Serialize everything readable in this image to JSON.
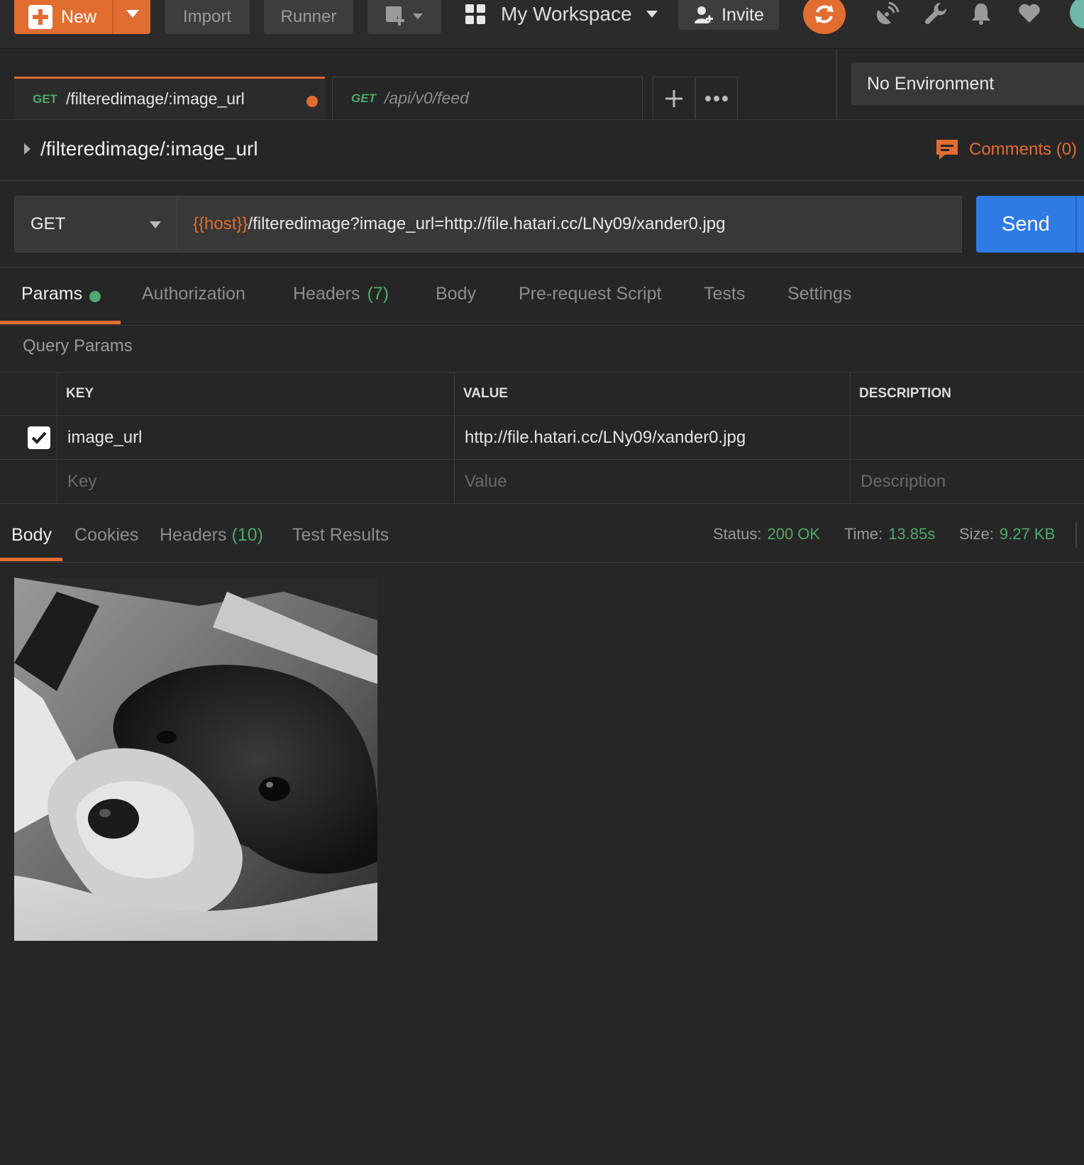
{
  "topbar": {
    "new_label": "New",
    "import_label": "Import",
    "runner_label": "Runner",
    "workspace_label": "My Workspace",
    "invite_label": "Invite"
  },
  "tabs": [
    {
      "method": "GET",
      "title": "/filteredimage/:image_url",
      "modified": true
    },
    {
      "method": "GET",
      "title": "/api/v0/feed",
      "modified": false
    }
  ],
  "environment": {
    "selected": "No Environment"
  },
  "request": {
    "title": "/filteredimage/:image_url",
    "comments_label": "Comments (0)",
    "method": "GET",
    "url_var": "{{host}}",
    "url_rest": "/filteredimage?image_url=http://file.hatari.cc/LNy09/xander0.jpg",
    "send_label": "Send"
  },
  "request_tabs": {
    "params": "Params",
    "authorization": "Authorization",
    "headers": "Headers",
    "headers_count": "(7)",
    "body": "Body",
    "prerequest": "Pre-request Script",
    "tests": "Tests",
    "settings": "Settings"
  },
  "query_params": {
    "label": "Query Params",
    "columns": {
      "key": "KEY",
      "value": "VALUE",
      "description": "DESCRIPTION"
    },
    "rows": [
      {
        "checked": true,
        "key": "image_url",
        "value": "http://file.hatari.cc/LNy09/xander0.jpg",
        "description": ""
      }
    ],
    "placeholders": {
      "key": "Key",
      "value": "Value",
      "description": "Description"
    }
  },
  "response": {
    "tabs": {
      "body": "Body",
      "cookies": "Cookies",
      "headers": "Headers",
      "headers_count": "(10)",
      "test_results": "Test Results"
    },
    "status_label": "Status:",
    "status_value": "200 OK",
    "time_label": "Time:",
    "time_value": "13.85s",
    "size_label": "Size:",
    "size_value": "9.27 KB"
  },
  "colors": {
    "accent": "#e16d31",
    "send_blue": "#2f7be5",
    "success_green": "#4fa86c",
    "background": "#262626"
  }
}
